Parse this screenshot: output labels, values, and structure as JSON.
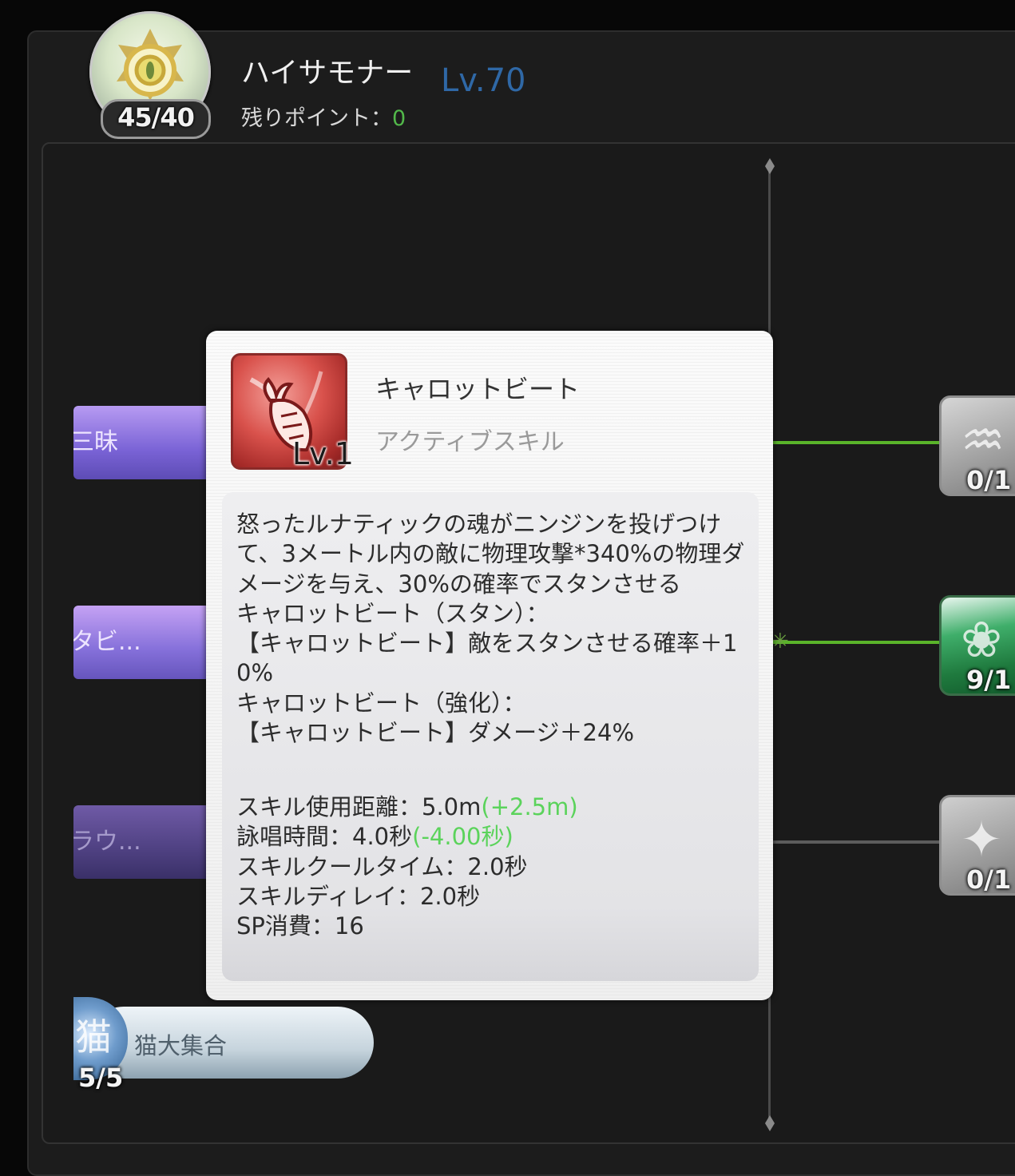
{
  "header": {
    "class_name": "ハイサモナー",
    "class_level": "Lv.70",
    "class_points": "45/40",
    "remaining_points_label": "残りポイント：",
    "remaining_points_value": "0"
  },
  "left_skills": [
    {
      "label": "三昧"
    },
    {
      "label": "タビ..."
    },
    {
      "label": "ラウ..."
    },
    {
      "label": "猫大集合",
      "count": "5/5",
      "icon": "cat-kanji-icon",
      "icon_glyph": "猫"
    }
  ],
  "right_skills": [
    {
      "count": "0/1",
      "icon": "fish-icon",
      "icon_glyph": "♒"
    },
    {
      "count": "9/1",
      "icon": "leaf-icon",
      "icon_glyph": "❀"
    },
    {
      "count": "0/1",
      "icon": "carrot-icon",
      "icon_glyph": "✦"
    }
  ],
  "tooltip": {
    "skill_name": "キャロットビート",
    "skill_type": "アクティブスキル",
    "skill_level": "Lv.1",
    "skill_icon": "carrot-icon",
    "description": "怒ったルナティックの魂がニンジンを投げつけて、3メートル内の敵に物理攻撃*340%の物理ダメージを与え、30%の確率でスタンさせる\nキャロットビート（スタン）：\n【キャロットビート】敵をスタンさせる確率＋10%\nキャロットビート（強化）：\n【キャロットビート】ダメージ＋24%",
    "stats": {
      "range_label": "スキル使用距離：5.0m",
      "range_bonus": "(+2.5m)",
      "cast_label": "詠唱時間：4.0秒",
      "cast_bonus": "(-4.00秒)",
      "cooldown": "スキルクールタイム：2.0秒",
      "delay": "スキルディレイ：2.0秒",
      "sp": "SP消費：16"
    }
  },
  "colors": {
    "level_blue": "#2f68a6",
    "points_green": "#52b84a",
    "bonus_green": "#5bd35b",
    "connector_green": "#5ab42a"
  }
}
